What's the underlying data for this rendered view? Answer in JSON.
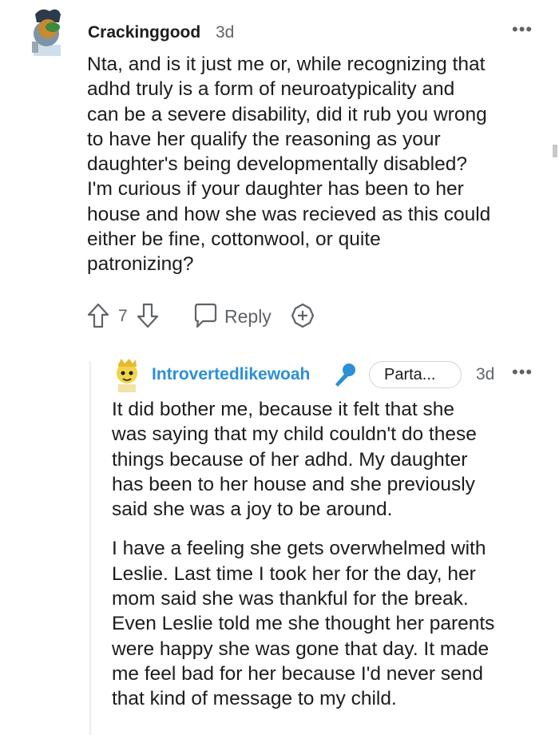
{
  "comment": {
    "author": "Crackinggood",
    "time": "3d",
    "more_label": "•••",
    "body": "Nta, and is it just me or, while recognizing that\nadhd truly is a form of neuroatypicality and\ncan be a severe disability, did it rub you wrong\nto have her qualify the reasoning as your\ndaughter's being developmentally disabled?\nI'm curious if your daughter has been to her\nhouse and how she was recieved as this could\neither be fine, cottonwool, or quite\npatronizing?",
    "vote_count": "7",
    "reply_label": "Reply",
    "icons": [
      "avatar",
      "upvote-icon",
      "downvote-icon",
      "reply-icon",
      "award-icon",
      "more-icon"
    ]
  },
  "reply": {
    "author": "Introvertedlikewoah",
    "flair": "Parta...",
    "time": "3d",
    "more_label": "•••",
    "paragraphs": [
      "It did bother me, because it felt that she\nwas saying that my child couldn't do these\nthings because of her adhd. My daughter\nhas been to her house and she previously\nsaid she was a joy to be around.",
      "I have a feeling she gets overwhelmed with\nLeslie. Last time I took her for the day, her\nmom said she was thankful for the break.\nEven Leslie told me she thought her parents\nwere happy she was gone that day. It made\nme feel bad for her because I'd never send\nthat kind of message to my child."
    ],
    "icons": [
      "avatar",
      "microphone-icon",
      "more-icon"
    ],
    "accent_color": "#2d8fd5"
  }
}
